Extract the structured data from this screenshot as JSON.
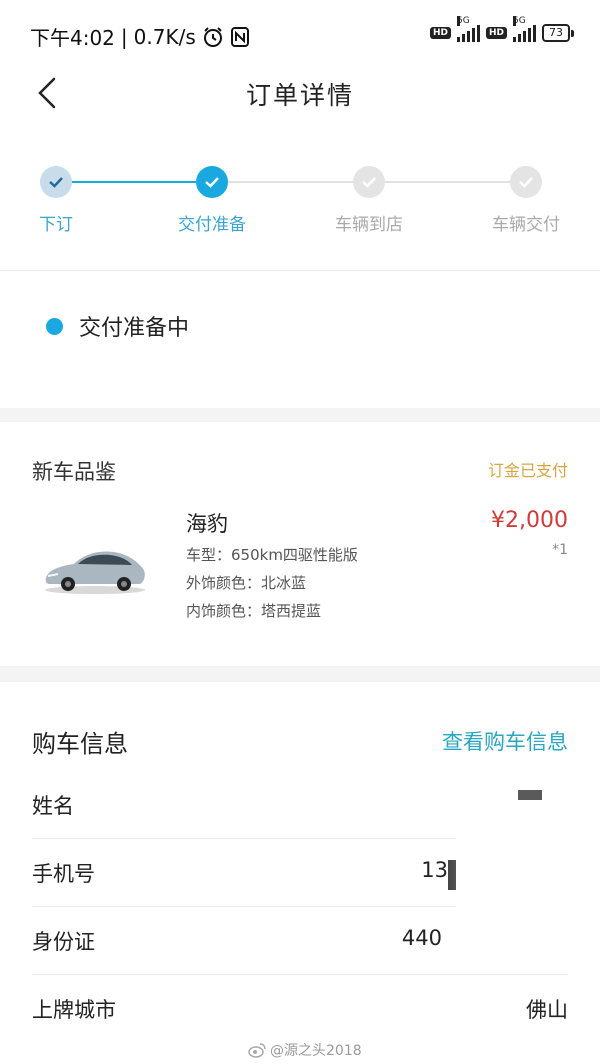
{
  "status_bar": {
    "time": "下午4:02",
    "speed": "0.7K/s",
    "network_label": "5G",
    "hd_label": "HD",
    "battery": "73"
  },
  "header": {
    "title": "订单详情"
  },
  "progress": {
    "steps": [
      {
        "label": "下订",
        "state": "done"
      },
      {
        "label": "交付准备",
        "state": "current"
      },
      {
        "label": "车辆到店",
        "state": "pending"
      },
      {
        "label": "车辆交付",
        "state": "pending"
      }
    ],
    "accent_color": "#1aa8e0"
  },
  "order_status": {
    "text": "交付准备中"
  },
  "product_section": {
    "title": "新车品鉴",
    "payment_status": "订金已支付",
    "car": {
      "name": "海豹",
      "model_line": "车型：650km四驱性能版",
      "exterior_line": "外饰颜色：北冰蓝",
      "interior_line": "内饰颜色：塔西提蓝",
      "price": "¥2,000",
      "quantity": "*1"
    }
  },
  "purchase_info": {
    "title": "购车信息",
    "view_link": "查看购车信息",
    "rows": [
      {
        "label": "姓名",
        "value": "乡"
      },
      {
        "label": "手机号",
        "value": "13"
      },
      {
        "label": "身份证",
        "value": "440"
      },
      {
        "label": "上牌城市",
        "value": "佛山"
      }
    ]
  },
  "watermark": {
    "text": "@源之头2018"
  }
}
